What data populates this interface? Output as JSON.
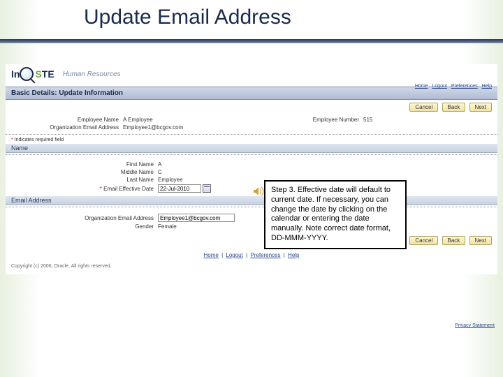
{
  "slide": {
    "title": "Update Email Address"
  },
  "logo": {
    "text_left": "In",
    "text_mid": "S",
    "text_right": "TE",
    "hr": "Human Resources"
  },
  "toplinks": {
    "home": "Home",
    "logout": "Logout",
    "prefs": "Preferences",
    "help": "Help"
  },
  "page_header": "Basic Details: Update Information",
  "buttons": {
    "cancel": "Cancel",
    "back": "Back",
    "next": "Next"
  },
  "employee": {
    "name_label": "Employee Name",
    "name_value": "A Employee",
    "org_email_label": "Organization Email Address",
    "org_email_value": "Employee1@bcgov.com",
    "number_label": "Employee Number",
    "number_value": "515"
  },
  "required_note": {
    "ast": "*",
    "text": " Indicates required field"
  },
  "sections": {
    "name": "Name",
    "email": "Email Address"
  },
  "form": {
    "first_label": "First Name",
    "first_value": "A",
    "middle_label": "Middle Name",
    "middle_value": "C",
    "last_label": "Last Name",
    "last_value": "Employee",
    "eff_label": "Email Effective Date",
    "eff_value": "22-Jul-2010",
    "org_label": "Organization Email Address",
    "org_value": "Employee1@bcgov.com",
    "gender_label": "Gender",
    "gender_value": "Female"
  },
  "callout": "Step 3. Effective date will default to current date. If necessary, you can change the date by clicking on the calendar or entering the date manually. Note correct date format, DD-MMM-YYYY.",
  "footer": {
    "home": "Home",
    "logout": "Logout",
    "prefs": "Preferences",
    "help": "Help",
    "copyright": "Copyright (c) 2006, Oracle. All rights reserved.",
    "privacy": "Privacy Statement"
  }
}
